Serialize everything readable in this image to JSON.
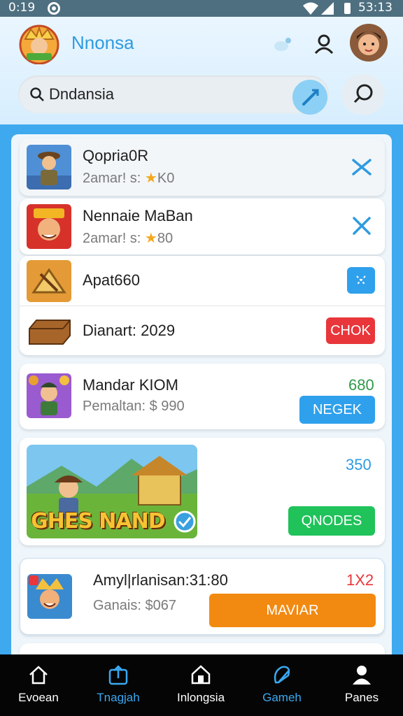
{
  "status_bar": {
    "time": "0:19",
    "clock": "53:13"
  },
  "header": {
    "app_title": "Nnonsa"
  },
  "search": {
    "value": "Dndansia"
  },
  "list": [
    {
      "name": "Qopria0R",
      "sub_prefix": "2amar! s:",
      "sub_value": "K0"
    },
    {
      "name": "Nennaie MaBan",
      "sub_prefix": "2amar! s:",
      "sub_value": "80"
    },
    {
      "name": "Apat660"
    },
    {
      "name": "Dianart: 2029",
      "button": "CHOK"
    },
    {
      "name": "Mandar KIOM",
      "sub": "Pemaltan: $ 990",
      "price": "680",
      "button": "NEGEK"
    },
    {
      "banner_text": "GHES NAND",
      "price": "350",
      "button": "QNODES"
    },
    {
      "name": "Amyl|rlanisan:31:80",
      "sub": "Ganais: $067",
      "price": "1X2",
      "button": "MAVIAR"
    }
  ],
  "nav": [
    {
      "label": "Evoean",
      "icon": "home-icon"
    },
    {
      "label": "Tnagjah",
      "icon": "upload-icon"
    },
    {
      "label": "Inlongsia",
      "icon": "house-icon"
    },
    {
      "label": "Gameh",
      "icon": "pen-icon"
    },
    {
      "label": "Panes",
      "icon": "person-icon"
    }
  ],
  "colors": {
    "accent": "#3fa9ef",
    "red": "#e8363b",
    "green": "#20c25a",
    "orange": "#f28a12",
    "blue_btn": "#2fa0ec"
  }
}
